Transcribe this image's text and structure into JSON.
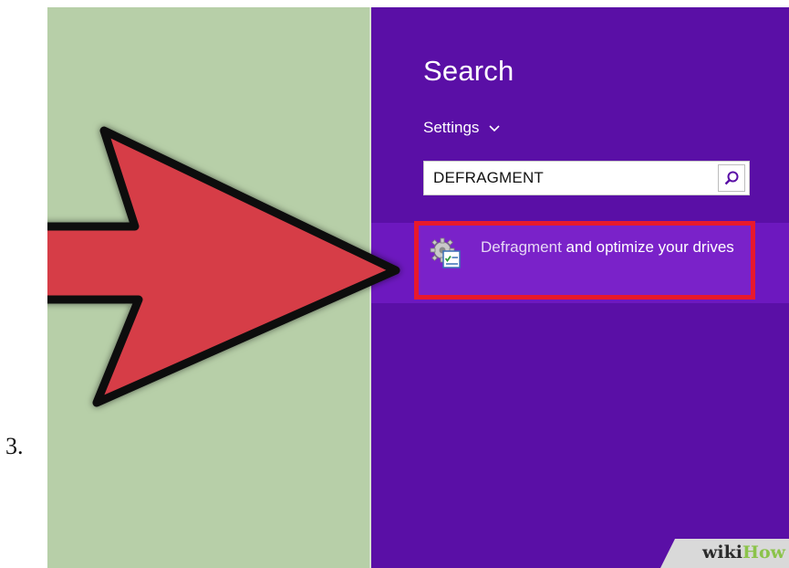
{
  "step": {
    "number": "3."
  },
  "search_pane": {
    "title": "Search",
    "scope_label": "Settings",
    "query_value": "DEFRAGMENT"
  },
  "result": {
    "match_text": "Defragment",
    "rest_text": " and optimize your drives"
  },
  "watermark": {
    "wiki": "wiki",
    "how": "How"
  },
  "icons": {
    "scope": "chevron-down-icon",
    "search": "search-icon",
    "result": "defrag-gear-checklist-icon",
    "pointer": "red-arrow-icon"
  },
  "colors": {
    "green_panel": "#b7cfa8",
    "purple_panel": "#5a0fa6",
    "result_highlight": "#6d18bf",
    "highlight_border": "#e8192c",
    "arrow_fill": "#d63c47"
  }
}
